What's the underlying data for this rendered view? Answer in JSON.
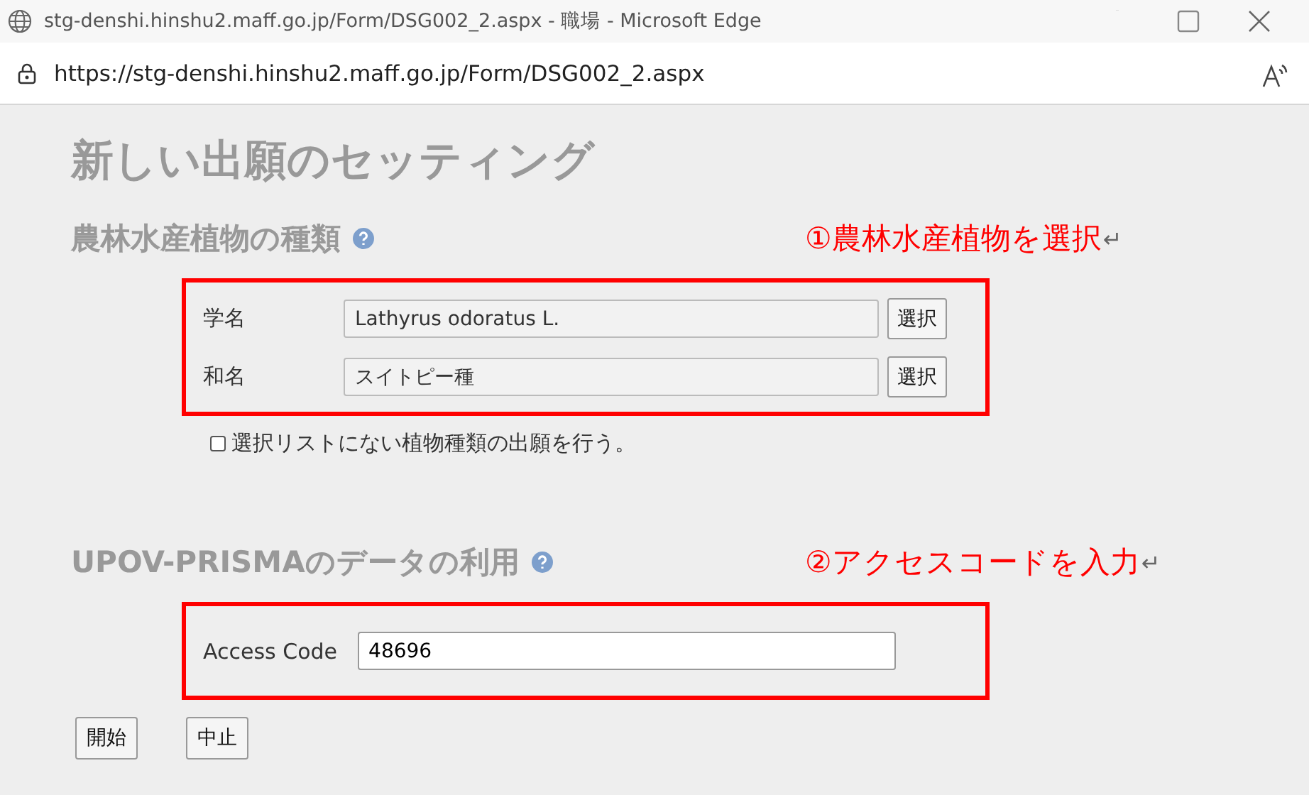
{
  "window": {
    "title": "stg-denshi.hinshu2.maff.go.jp/Form/DSG002_2.aspx - 職場 - Microsoft Edge"
  },
  "address_bar": {
    "url": "https://stg-denshi.hinshu2.maff.go.jp/Form/DSG002_2.aspx"
  },
  "page": {
    "title": "新しい出願のセッティング",
    "sections": [
      {
        "heading": "農林水産植物の種類",
        "annotation": {
          "text": "①農林水産植物を選択",
          "end_mark": "↵"
        },
        "fields": [
          {
            "label": "学名",
            "value": "Lathyrus odoratus L.",
            "readonly": true,
            "button": "選択"
          },
          {
            "label": "和名",
            "value": "スイトピー種",
            "readonly": true,
            "button": "選択"
          }
        ],
        "checkbox": {
          "label": "選択リストにない植物種類の出願を行う。",
          "checked": false
        }
      },
      {
        "heading": "UPOV-PRISMAのデータの利用",
        "annotation": {
          "text": "②アクセスコードを入力",
          "end_mark": "↵"
        },
        "fields": [
          {
            "label": "Access Code",
            "value": "48696",
            "readonly": false
          }
        ]
      }
    ],
    "buttons": [
      "開始",
      "中止"
    ]
  }
}
